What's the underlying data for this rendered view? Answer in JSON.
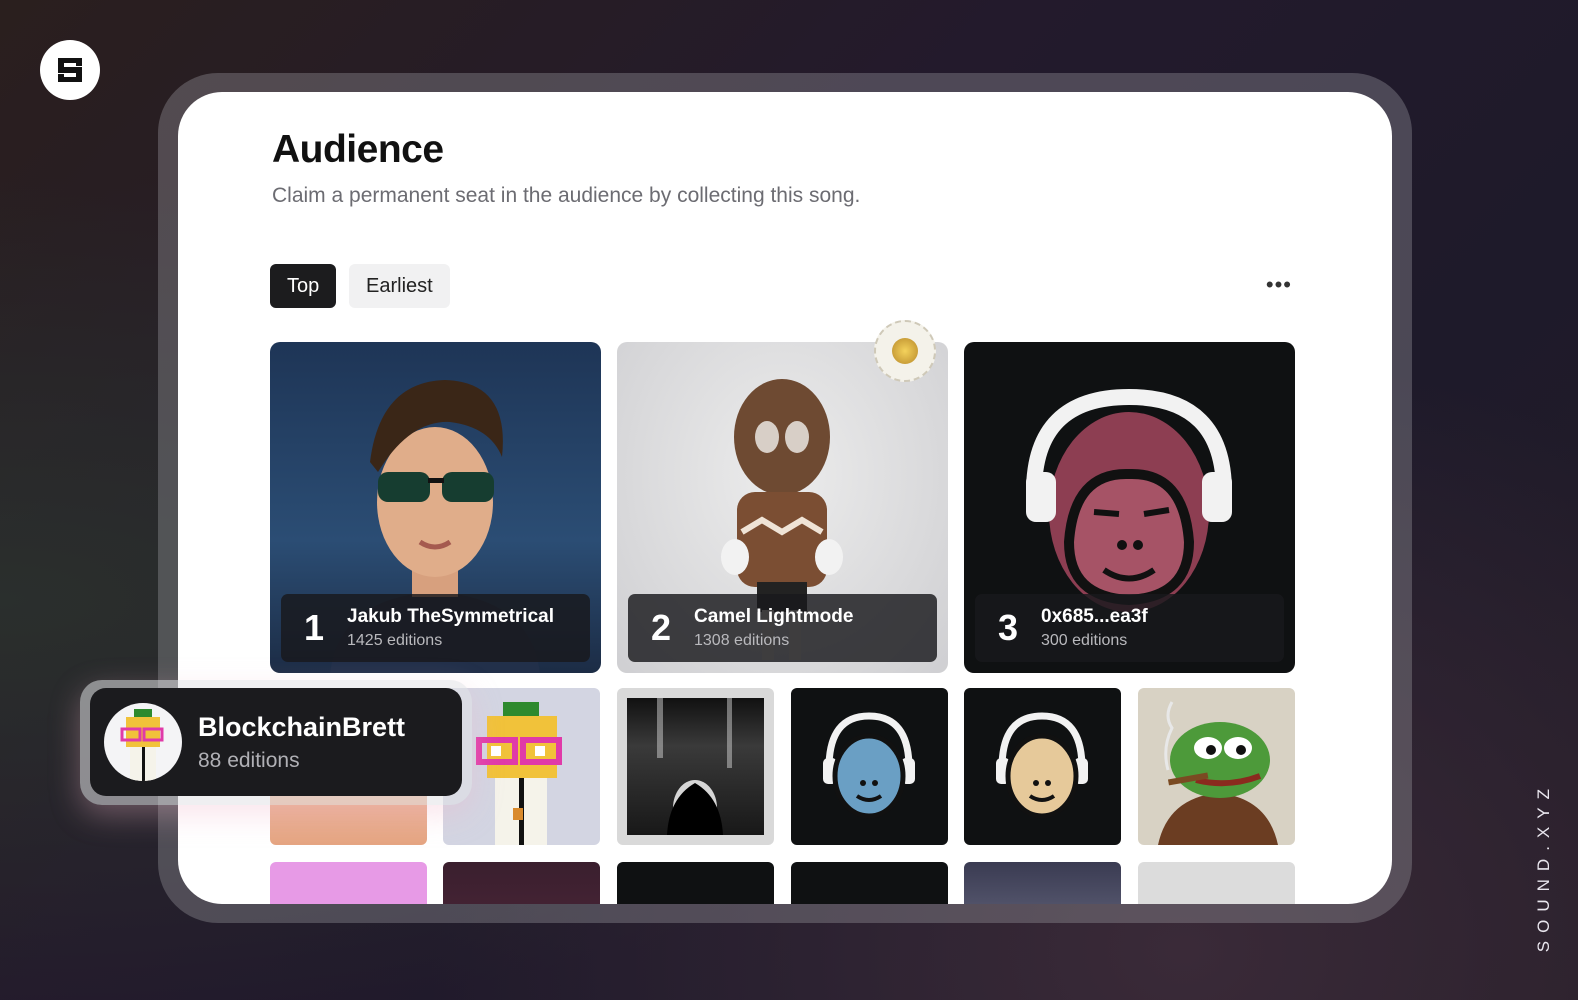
{
  "brand": {
    "site": "SOUND.XYZ",
    "logo_icon": "sound-logo-icon"
  },
  "header": {
    "title": "Audience",
    "subtitle": "Claim a permanent seat in the audience by collecting this song."
  },
  "tabs": [
    {
      "label": "Top",
      "active": true
    },
    {
      "label": "Earliest",
      "active": false
    }
  ],
  "more_label": "•••",
  "top_collectors": [
    {
      "rank": "1",
      "name": "Jakub TheSymmetrical",
      "editions": "1425 editions"
    },
    {
      "rank": "2",
      "name": "Camel Lightmode",
      "editions": "1308 editions",
      "badge": "GOLDEN EGG"
    },
    {
      "rank": "3",
      "name": "0x685...ea3f",
      "editions": "300 editions"
    }
  ],
  "tooltip": {
    "name": "BlockchainBrett",
    "editions": "88 editions"
  },
  "colors": {
    "accent": "#1c1c1e",
    "card": "#ffffff",
    "muted": "#6c6c72"
  }
}
